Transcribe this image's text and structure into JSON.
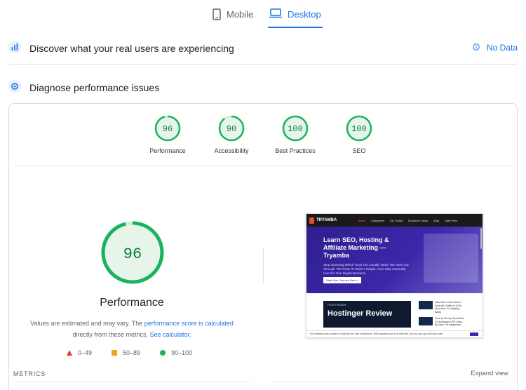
{
  "tabs": [
    {
      "label": "Mobile",
      "icon": "phone-icon",
      "active": false
    },
    {
      "label": "Desktop",
      "icon": "laptop-icon",
      "active": true
    }
  ],
  "real_users": {
    "title": "Discover what your real users are experiencing",
    "status": "No Data"
  },
  "diagnose": {
    "title": "Diagnose performance issues"
  },
  "scores": [
    {
      "label": "Performance",
      "value": 96
    },
    {
      "label": "Accessibility",
      "value": 90
    },
    {
      "label": "Best Practices",
      "value": 100
    },
    {
      "label": "SEO",
      "value": 100
    }
  ],
  "main_score": {
    "value": 96,
    "label": "Performance",
    "desc_prefix": "Values are estimated and may vary. The ",
    "desc_link1": "performance score is calculated",
    "desc_mid": "directly from these metrics. ",
    "desc_link2": "See calculator."
  },
  "legend": [
    {
      "range": "0–49",
      "color": "#e53935",
      "shape": "triangle"
    },
    {
      "range": "50–89",
      "color": "#f4a11a",
      "shape": "square"
    },
    {
      "range": "90–100",
      "color": "#18b45b",
      "shape": "circle"
    }
  ],
  "metrics": {
    "label": "METRICS",
    "expand": "Expand view"
  },
  "thumbnail": {
    "logo": "TRYAMBA",
    "menu": [
      "Home",
      "Categories",
      "My Toolkit",
      "Exclusive Deals",
      "Blog",
      "Start Here"
    ],
    "hero_title": "Learn SEO, Hosting & Affiliate Marketing — Tryamba",
    "hero_sub": "Stop Guessing Which Tools You Actually Need. We Have Cut Through The Noise To Build A Simple, Four-Step Assembly Line For Your Digital Business.",
    "hero_button": "Start Your Journey Here »",
    "card_small": "HOSTINGER",
    "card_title": "Hostinger Review",
    "side_items": [
      "How Zoho Click Search Drive My Traffic In 2026 (And How I'm Fighting Back)",
      "How To Set Up OpenClaw On Hostinger VPS (Step-By-Step For Beginners)"
    ],
    "footer_text": "This website uses cookies to improve the user experience. We'll assume you're ok with this, but you can opt-out if you wish."
  },
  "colors": {
    "accent": "#1a73e8",
    "good": "#18b45b",
    "good_text": "#0c7d3d",
    "good_fill": "#e6f4ea"
  }
}
